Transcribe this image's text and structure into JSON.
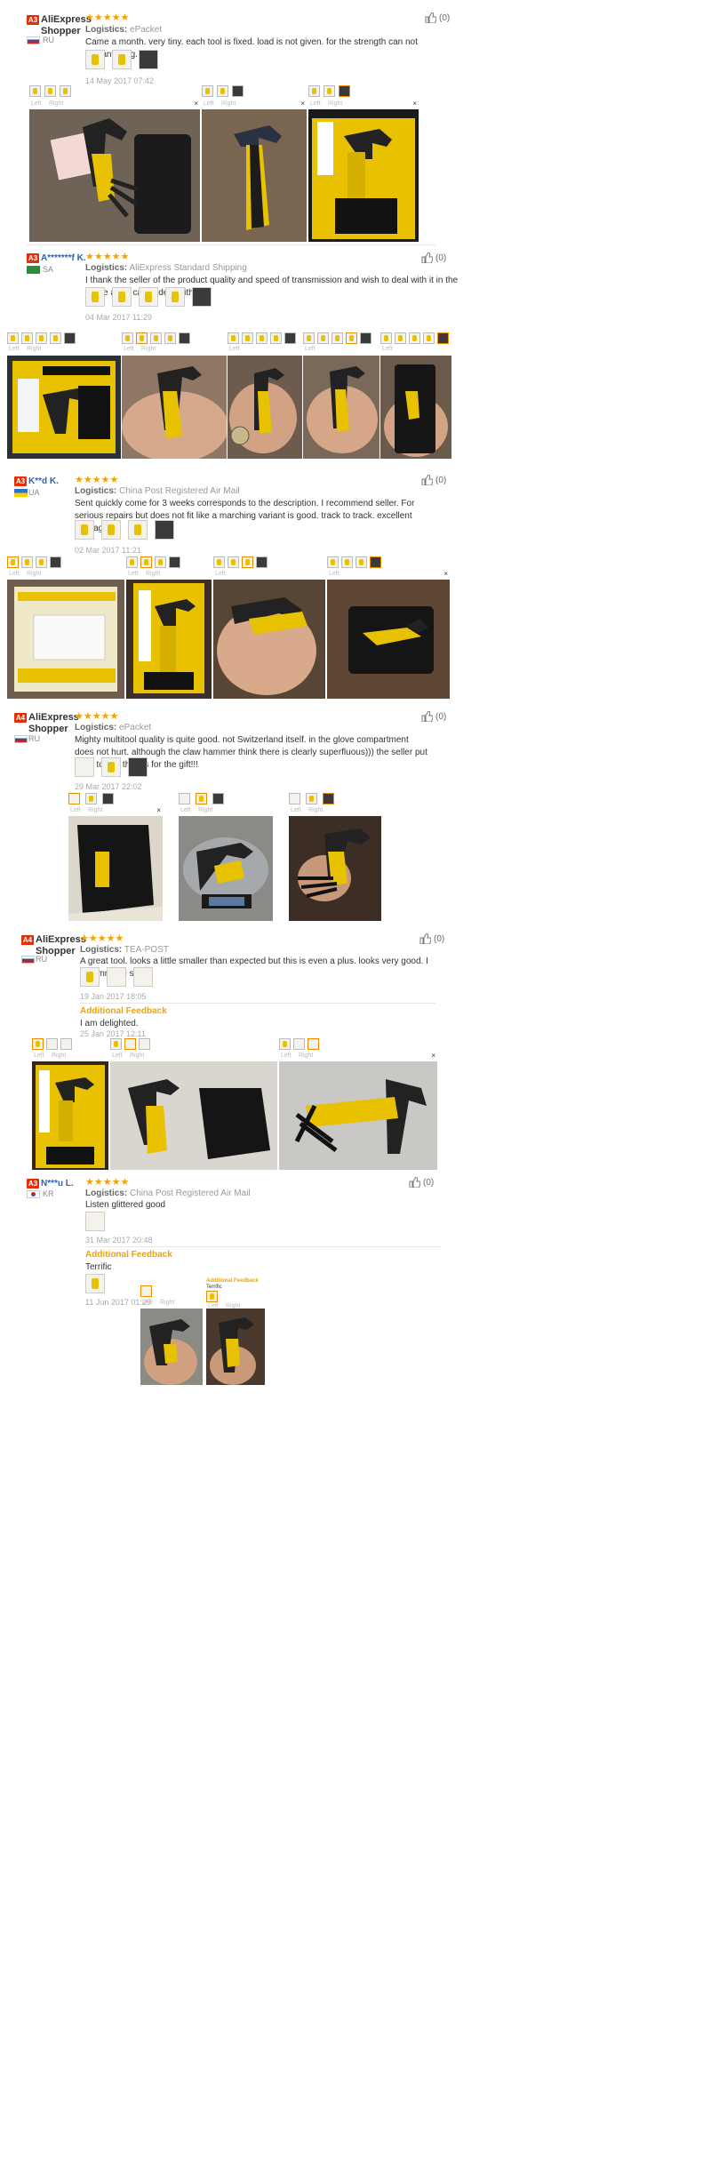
{
  "reviews": [
    {
      "badge": "A3",
      "name": "AliExpress Shopper",
      "country": "RU",
      "stars": "★★★★★",
      "logistics_label": "Logistics:",
      "logistics": "ePacket",
      "text": "Came a month. very tiny. each tool is fixed. load is not given. for the strength can not say anything.",
      "date": "14 May 2017 07:42",
      "likes": "(0)"
    },
    {
      "badge": "A3",
      "name": "A*******f K.",
      "country": "SA",
      "stars": "★★★★★",
      "logistics_label": "Logistics:",
      "logistics": "AliExpress Standard Shipping",
      "text": "I thank the seller of the product quality and speed of transmission and wish to deal with it in the future and I call to deal with it",
      "date": "04 Mar 2017 11:29",
      "likes": "(0)"
    },
    {
      "badge": "A3",
      "name": "K**d K.",
      "country": "UA",
      "stars": "★★★★★",
      "logistics_label": "Logistics:",
      "logistics": "China Post Registered Air Mail",
      "text": "Sent quickly come for 3 weeks corresponds to the description. I recommend seller. For serious repairs but does not fit like a marching variant is good. track to track. excellent packaging.",
      "date": "02 Mar 2017 11:21",
      "likes": "(0)"
    },
    {
      "badge": "A4",
      "name": "AliExpress Shopper",
      "country": "RU",
      "stars": "★★★★★",
      "logistics_label": "Logistics:",
      "logistics": "ePacket",
      "text": "Mighty multitool quality is quite good. not Switzerland itself. in the glove compartment does not hurt. although the claw hammer think there is clearly superfluous))) the seller put a gift towel) thanks for the gift!!!",
      "date": "29 Mar 2017 22:02",
      "likes": "(0)"
    },
    {
      "badge": "A4",
      "name": "AliExpress Shopper",
      "country": "RU",
      "stars": "★★★★★",
      "logistics_label": "Logistics:",
      "logistics": "TEA-POST",
      "text": "A great tool. looks a little smaller than expected but this is even a plus. looks very good. I recommend seller.",
      "date": "19 Jan 2017 18:05",
      "additional_label": "Additional Feedback",
      "additional_text": "I am delighted.",
      "additional_date": "25 Jan 2017 12:11",
      "likes": "(0)"
    },
    {
      "badge": "A3",
      "name": "N***u L.",
      "country": "KR",
      "stars": "★★★★★",
      "logistics_label": "Logistics:",
      "logistics": "China Post Registered Air Mail",
      "text": "Listen glittered good",
      "date": "31 Mar 2017 20:48",
      "additional_label": "Additional Feedback",
      "additional_text": "Terrific",
      "additional_date": "11 Jun 2017 01:29",
      "likes": "(0)"
    }
  ],
  "viewer": {
    "left": "Left",
    "right": "Right",
    "close": "×"
  },
  "mini_viewer": {
    "additional_label": "Additional Feedback",
    "additional_text": "Terrific"
  },
  "colors": {
    "accent": "#f5a100",
    "badge": "#e62e04",
    "link": "#2f5fb8"
  }
}
